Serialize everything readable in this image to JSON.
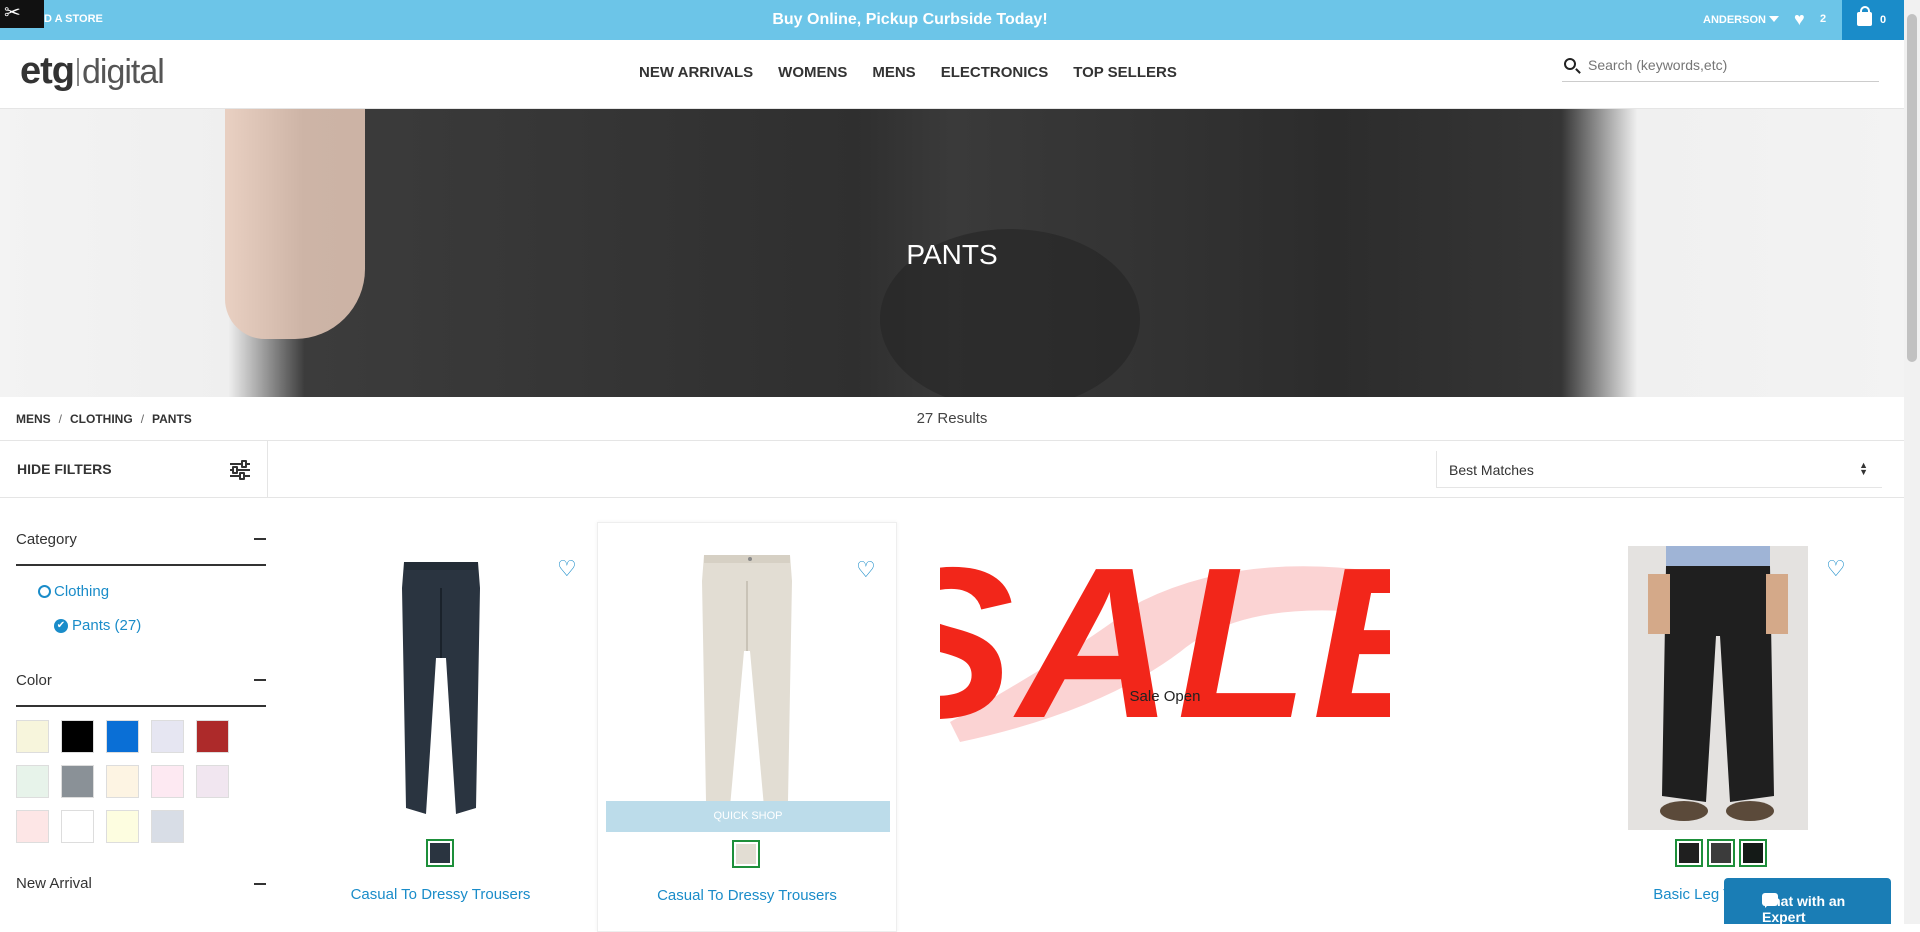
{
  "topbar": {
    "find_store": "D A STORE",
    "promo": "Buy Online, Pickup Curbside Today!",
    "user": "ANDERSON",
    "wishlist_count": "2",
    "cart_count": "0",
    "tools_icon": "tools-icon",
    "background": "#6cc5e8"
  },
  "header": {
    "logo_main": "etg",
    "logo_sub": "digital",
    "nav": [
      "NEW ARRIVALS",
      "WOMENS",
      "MENS",
      "ELECTRONICS",
      "TOP SELLERS"
    ],
    "search_placeholder": "Search (keywords,etc)"
  },
  "hero": {
    "title": "PANTS"
  },
  "breadcrumb": [
    "MENS",
    "CLOTHING",
    "PANTS"
  ],
  "results_count": "27 Results",
  "filters": {
    "hide_label": "HIDE FILTERS",
    "sort_value": "Best Matches",
    "category": {
      "title": "Category",
      "items": [
        {
          "label": "Clothing",
          "selected": false
        },
        {
          "label": "Pants (27)",
          "selected": true
        }
      ]
    },
    "color": {
      "title": "Color",
      "swatches": [
        "#f7f5dc",
        "#000000",
        "#0a6fd6",
        "#e6e6f2",
        "#ad2a2a",
        "#e7f3ea",
        "#8a9197",
        "#fdf4e3",
        "#fde9f2",
        "#f1e6f0",
        "#fde6e6",
        "#ffffff",
        "#fdfde0",
        "#d8dde6"
      ]
    },
    "new_arrival": {
      "title": "New Arrival"
    }
  },
  "products": [
    {
      "name": "Casual To Dressy Trousers",
      "swatches": [
        "#2a3440"
      ]
    },
    {
      "name": "Casual To Dressy Trousers",
      "swatches": [
        "#e2ddd3"
      ],
      "quick_shop": "QUICK SHOP"
    },
    {
      "sale_caption": "Sale Open",
      "sale_word": "SALE"
    },
    {
      "name": "Basic Leg Trousers",
      "swatches": [
        "#1f1f1f",
        "#3b3b3b",
        "#141a17"
      ]
    }
  ],
  "chat": {
    "label": "Chat with an Expert"
  },
  "colors": {
    "accent": "#1a8cc9",
    "cart_bg": "#1a8cc9",
    "chat_bg": "#1a7db5",
    "sale_red": "#f2261a"
  }
}
